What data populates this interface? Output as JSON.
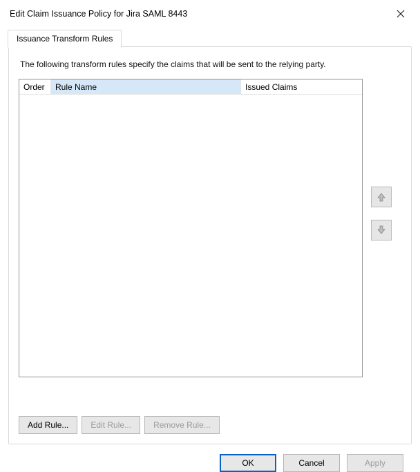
{
  "window": {
    "title": "Edit Claim Issuance Policy for Jira SAML 8443"
  },
  "tabs": {
    "active_label": "Issuance Transform Rules"
  },
  "panel": {
    "description": "The following transform rules specify the claims that will be sent to the relying party."
  },
  "columns": {
    "order": "Order",
    "rule_name": "Rule Name",
    "issued_claims": "Issued Claims"
  },
  "buttons": {
    "add_rule": "Add Rule...",
    "edit_rule": "Edit Rule...",
    "remove_rule": "Remove Rule...",
    "ok": "OK",
    "cancel": "Cancel",
    "apply": "Apply"
  }
}
